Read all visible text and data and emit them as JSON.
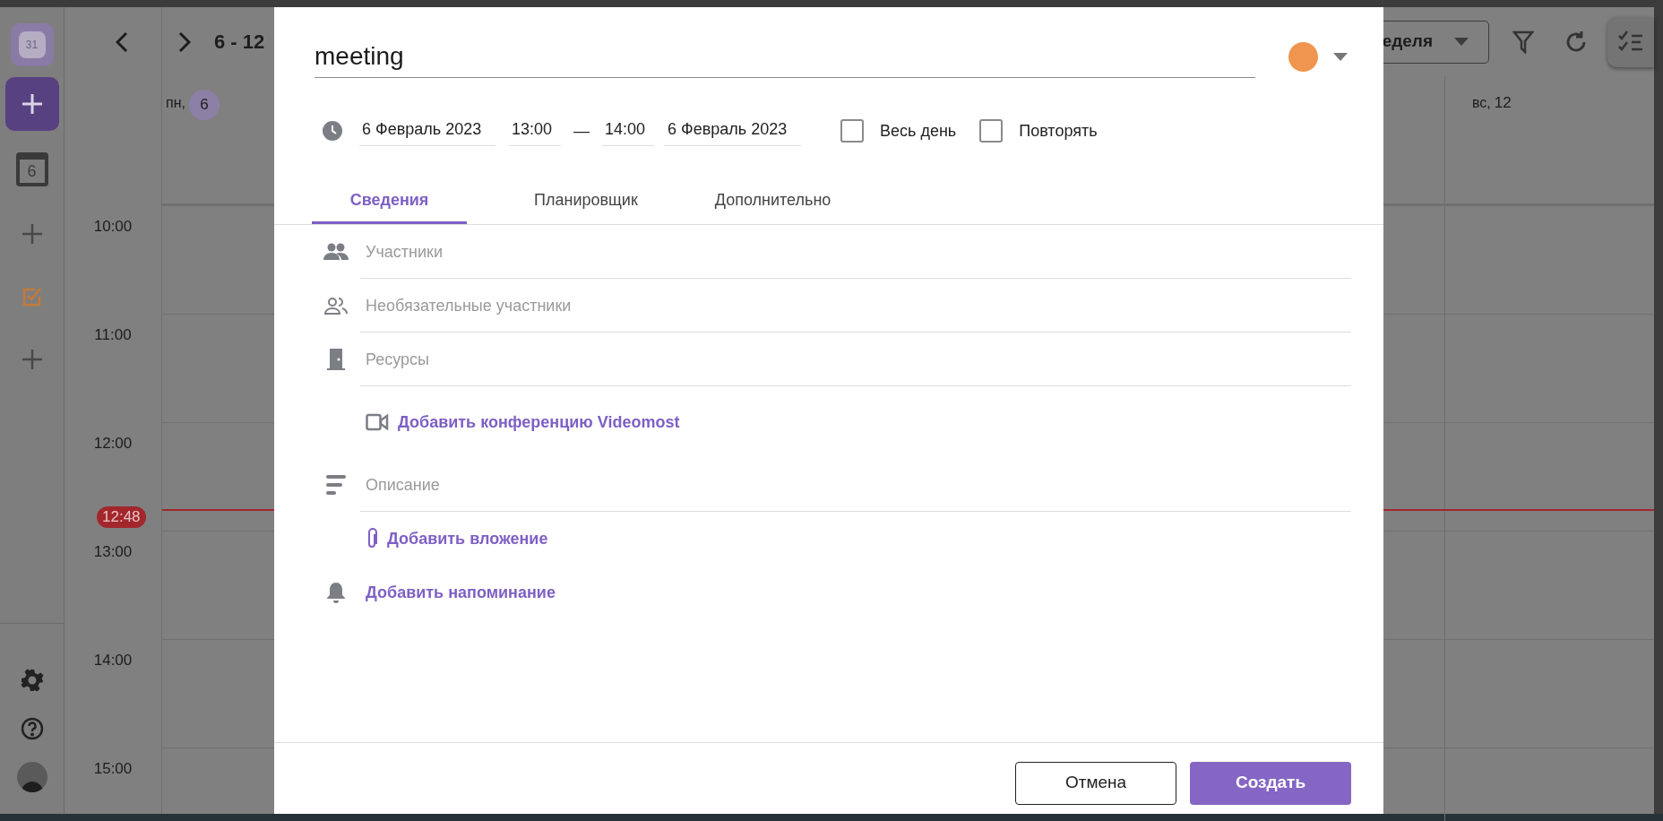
{
  "sidebar": {
    "logo_text": "31",
    "calendar_day": "6"
  },
  "toolbar": {
    "range": "6 - 12",
    "view": "еделя"
  },
  "day_headers": [
    {
      "weekday": "пн,",
      "day": "6",
      "selected": true
    },
    {
      "weekday": "вс,",
      "day": "12",
      "selected": false
    }
  ],
  "hours": [
    "10:00",
    "11:00",
    "12:00",
    "13:00",
    "14:00",
    "15:00"
  ],
  "now": {
    "label": "12:48"
  },
  "dialog": {
    "title": "meeting",
    "color": "#f0954f",
    "start_date": "6 Февраль 2023",
    "start_time": "13:00",
    "dash": "—",
    "end_time": "14:00",
    "end_date": "6 Февраль 2023",
    "checks": [
      {
        "label": "Весь день",
        "checked": false
      },
      {
        "label": "Повторять",
        "checked": false
      }
    ],
    "tabs": [
      {
        "label": "Сведения",
        "selected": true
      },
      {
        "label": "Планировщик",
        "selected": false
      },
      {
        "label": "Дополнительно",
        "selected": false
      }
    ],
    "rows": [
      {
        "kind": "field",
        "placeholder": "Участники"
      },
      {
        "kind": "field",
        "placeholder": "Необязательные участники"
      },
      {
        "kind": "field",
        "placeholder": "Ресурсы"
      },
      {
        "kind": "link",
        "text": "Добавить конференцию Videomost"
      },
      {
        "kind": "field",
        "placeholder": "Описание"
      },
      {
        "kind": "link",
        "text": "Добавить вложение"
      },
      {
        "kind": "link",
        "text": "Добавить напоминание"
      }
    ],
    "buttons": [
      {
        "label": "Отмена",
        "kind": "secondary"
      },
      {
        "label": "Создать",
        "kind": "primary"
      }
    ]
  }
}
